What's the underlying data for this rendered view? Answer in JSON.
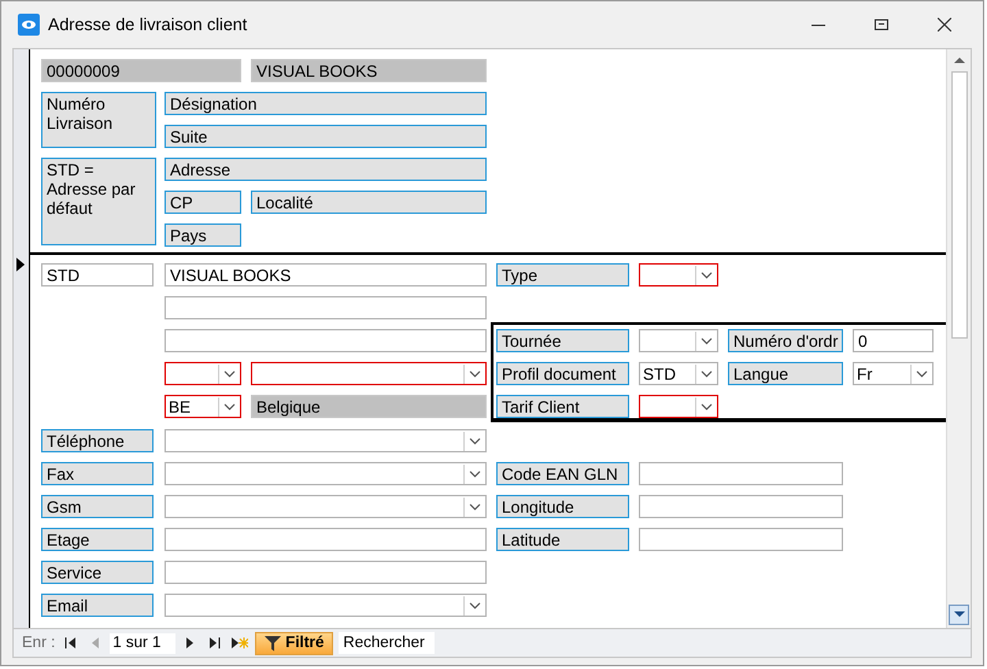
{
  "window": {
    "title": "Adresse de livraison client"
  },
  "header_controls": [
    {
      "kind": "display",
      "text": "00000009"
    },
    {
      "kind": "display",
      "text": "VISUAL BOOKS"
    },
    {
      "kind": "label",
      "text": "Numéro Livraison"
    },
    {
      "kind": "label",
      "text": "Désignation"
    },
    {
      "kind": "label",
      "text": "Suite"
    },
    {
      "kind": "label",
      "text": "STD = Adresse par défaut"
    },
    {
      "kind": "label",
      "text": "Adresse"
    },
    {
      "kind": "label",
      "text": "CP"
    },
    {
      "kind": "label",
      "text": "Localité"
    },
    {
      "kind": "label",
      "text": "Pays"
    }
  ],
  "detail_controls": [
    {
      "kind": "input",
      "text": "STD",
      "required": false
    },
    {
      "kind": "input",
      "text": "VISUAL BOOKS",
      "required": false
    },
    {
      "kind": "label",
      "text": "Type"
    },
    {
      "kind": "combo",
      "required": true
    },
    {
      "kind": "input",
      "required": false
    },
    {
      "kind": "input",
      "required": false
    },
    {
      "kind": "label",
      "text": "Tournée"
    },
    {
      "kind": "combo",
      "required": false
    },
    {
      "kind": "label",
      "text": "Numéro d'ordr"
    },
    {
      "kind": "input",
      "text": "0",
      "required": false
    },
    {
      "kind": "combo",
      "required": true
    },
    {
      "kind": "combo",
      "required": true
    },
    {
      "kind": "label",
      "text": "Profil document"
    },
    {
      "kind": "combo",
      "text": "STD",
      "required": false
    },
    {
      "kind": "label",
      "text": "Langue"
    },
    {
      "kind": "combo",
      "text": "Fr",
      "required": false
    },
    {
      "kind": "combo",
      "text": "BE",
      "required": true
    },
    {
      "kind": "display",
      "text": "Belgique"
    },
    {
      "kind": "label",
      "text": "Tarif Client"
    },
    {
      "kind": "combo",
      "required": true
    },
    {
      "kind": "label",
      "text": "Téléphone"
    },
    {
      "kind": "combo",
      "required": false
    },
    {
      "kind": "label",
      "text": "Fax"
    },
    {
      "kind": "combo",
      "required": false
    },
    {
      "kind": "label",
      "text": "Code EAN GLN"
    },
    {
      "kind": "input",
      "required": false
    },
    {
      "kind": "label",
      "text": "Gsm"
    },
    {
      "kind": "combo",
      "required": false
    },
    {
      "kind": "label",
      "text": "Longitude"
    },
    {
      "kind": "input",
      "required": false
    },
    {
      "kind": "label",
      "text": "Etage"
    },
    {
      "kind": "input",
      "required": false
    },
    {
      "kind": "label",
      "text": "Latitude"
    },
    {
      "kind": "input",
      "required": false
    },
    {
      "kind": "label",
      "text": "Service"
    },
    {
      "kind": "input",
      "required": false
    },
    {
      "kind": "label",
      "text": "Email"
    },
    {
      "kind": "combo",
      "required": false
    }
  ],
  "navigation": {
    "label": "Enr :",
    "position": "1 sur 1",
    "filter": "Filtré",
    "search": {
      "placeholder": "Rechercher"
    }
  }
}
